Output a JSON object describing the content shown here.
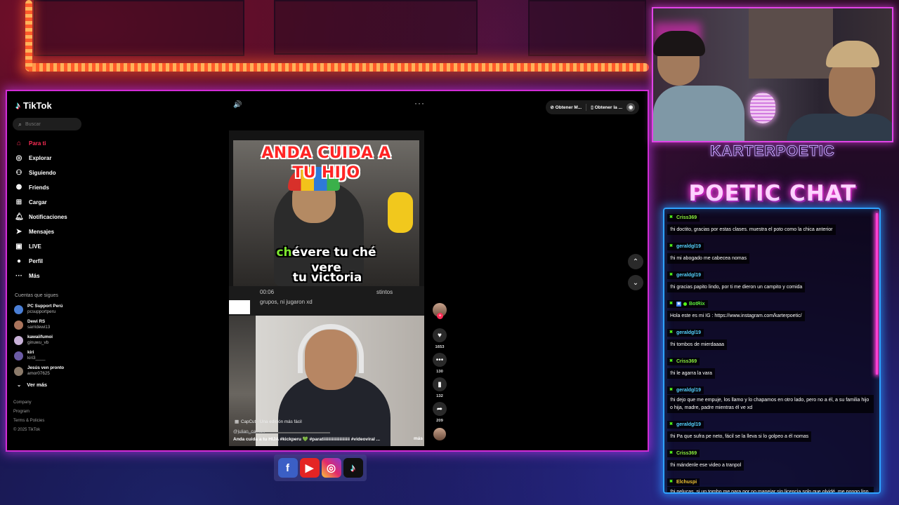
{
  "tiktok": {
    "logo": "TikTok",
    "search_placeholder": "Buscar",
    "nav": [
      {
        "icon": "home-icon",
        "label": "Para ti",
        "active": true
      },
      {
        "icon": "compass-icon",
        "label": "Explorar"
      },
      {
        "icon": "following-icon",
        "label": "Siguiendo"
      },
      {
        "icon": "friends-icon",
        "label": "Friends"
      },
      {
        "icon": "upload-icon",
        "label": "Cargar"
      },
      {
        "icon": "bell-icon",
        "label": "Notificaciones"
      },
      {
        "icon": "send-icon",
        "label": "Mensajes"
      },
      {
        "icon": "live-icon",
        "label": "LIVE"
      },
      {
        "icon": "profile-icon",
        "label": "Perfil"
      },
      {
        "icon": "more-icon",
        "label": "Más"
      }
    ],
    "following_title": "Cuentas que sigues",
    "following": [
      {
        "name": "PC Support Perú",
        "handle": "pcsupportperu",
        "color": "#4a7fd6"
      },
      {
        "name": "Dewi RS",
        "handle": "sarridewi13",
        "color": "#a9745c"
      },
      {
        "name": "kawaiifumoi",
        "handle": "ginuwu_vb",
        "color": "#c8b1d8"
      },
      {
        "name": "kiri",
        "handle": "kiri3____",
        "color": "#6b5ba5"
      },
      {
        "name": "Jesús ven pronto",
        "handle": "amor07625",
        "color": "#8b7a6a"
      }
    ],
    "ver_mas": "Ver más",
    "footer": [
      "Company",
      "Program",
      "Terms & Policies",
      "© 2025 TikTok"
    ],
    "top_right": {
      "btn1": "Obtener M...",
      "btn2": "Obtener la ..."
    },
    "video": {
      "headline_line1": "ANDA CUIDA A",
      "headline_line2": "TU HIJO",
      "caption_hl": "ch",
      "caption_rest": "évere tu ché",
      "caption_line2": "vere",
      "caption_line3": "tu victoria",
      "reply_time": "00:06",
      "reply_text": "grupos, ni jugaron xd",
      "reply_right": "stintos",
      "capcut": "CapCut · Una edición más fácil",
      "handle": "@julian_carrion",
      "description": "Anda cuida a tu HIJA #kickperu 💚 #paratiiiiiiiiiiiiiiiiiiiii #videoviral ...",
      "more": "más"
    },
    "actions": {
      "likes": "1653",
      "comments": "130",
      "saves": "132",
      "shares": "209"
    }
  },
  "stream": {
    "channel": "KARTERPOETIC",
    "chat_title": "POETIC CHAT",
    "messages": [
      {
        "user": "Criss369",
        "color": "#8cf23c",
        "text": "!hi doctito, gracias por estas clases. muestra el poto como la chica anterior"
      },
      {
        "user": "geraldgl19",
        "color": "#55d3ff",
        "text": "!hi mi abogado me cabecea nomas"
      },
      {
        "user": "geraldgl19",
        "color": "#55d3ff",
        "text": "!hi gracias papito lindo, por ti me dieron un campito y comida"
      },
      {
        "user": "BotRix",
        "color": "#5cf03a",
        "bot": true,
        "text": "Hola este es mi IG : https://www.instagram.com/karterpoetic/"
      },
      {
        "user": "geraldgl19",
        "color": "#55d3ff",
        "text": "!hi tombos de mierdaaaa"
      },
      {
        "user": "Criss369",
        "color": "#8cf23c",
        "text": "!hi le agarra la vara"
      },
      {
        "user": "geraldgl19",
        "color": "#55d3ff",
        "text": "!hi dejo que me empuje, los llamo y lo chapamos en otro lado, pero no a él, a su familia hijo o hija, madre, padre mientras él ve xd"
      },
      {
        "user": "geraldgl19",
        "color": "#55d3ff",
        "text": "!hi Pa que sufra pe neto, fácil se la lleva si lo golpeo a él nomas"
      },
      {
        "user": "Criss369",
        "color": "#8cf23c",
        "text": "!hi mándenle ese video a tranpol"
      },
      {
        "user": "Elchuspi",
        "color": "#f2c533",
        "text": "!hi pelucas, si un tombo me para por no manejar sin licencia solo que olvidé, me pongo liso y se autogrede él, puedo denunciarlo por falsedad genérica?"
      }
    ],
    "socials": [
      "f",
      "▶",
      "◎",
      "♪"
    ]
  }
}
